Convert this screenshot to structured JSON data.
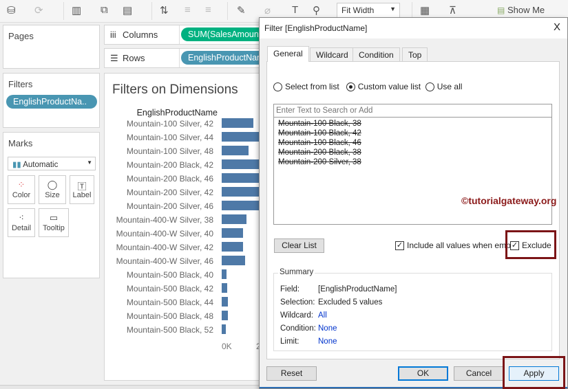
{
  "toolbar": {
    "fit_label": "Fit Width",
    "show_me": "Show Me"
  },
  "shelves": {
    "pages": "Pages",
    "filters": "Filters",
    "filter_pill": "EnglishProductNa..",
    "marks": "Marks",
    "mark_type": "Automatic",
    "columns": "Columns",
    "columns_pill": "SUM(SalesAmount)",
    "rows": "Rows",
    "rows_pill": "EnglishProductName"
  },
  "marks_buttons": [
    "Color",
    "Size",
    "Label",
    "Detail",
    "Tooltip"
  ],
  "viz": {
    "title": "Filters on Dimensions",
    "header": "EnglishProductName",
    "axis_tick": "0K",
    "axis_tick2": "2",
    "rows": [
      {
        "label": "Mountain-100 Silver, 42",
        "value": 46
      },
      {
        "label": "Mountain-100 Silver, 44",
        "value": 60
      },
      {
        "label": "Mountain-100 Silver, 48",
        "value": 39
      },
      {
        "label": "Mountain-200 Black, 42",
        "value": 60
      },
      {
        "label": "Mountain-200 Black, 46",
        "value": 60
      },
      {
        "label": "Mountain-200 Silver, 42",
        "value": 60
      },
      {
        "label": "Mountain-200 Silver, 46",
        "value": 60
      },
      {
        "label": "Mountain-400-W Silver, 38",
        "value": 36
      },
      {
        "label": "Mountain-400-W Silver, 40",
        "value": 31
      },
      {
        "label": "Mountain-400-W Silver, 42",
        "value": 31
      },
      {
        "label": "Mountain-400-W Silver, 46",
        "value": 34
      },
      {
        "label": "Mountain-500 Black, 40",
        "value": 7
      },
      {
        "label": "Mountain-500 Black, 42",
        "value": 8
      },
      {
        "label": "Mountain-500 Black, 44",
        "value": 9
      },
      {
        "label": "Mountain-500 Black, 48",
        "value": 9
      },
      {
        "label": "Mountain-500 Black, 52",
        "value": 6
      }
    ]
  },
  "dialog": {
    "title": "Filter [EnglishProductName]",
    "close": "X",
    "tabs": [
      "General",
      "Wildcard",
      "Condition",
      "Top"
    ],
    "radios": [
      "Select from list",
      "Custom value list",
      "Use all"
    ],
    "search_placeholder": "Enter Text to Search or Add",
    "items": [
      "Mountain-100 Black, 38",
      "Mountain-100 Black, 42",
      "Mountain-100 Black, 46",
      "Mountain-200 Black, 38",
      "Mountain-200 Silver, 38"
    ],
    "watermark": "©tutorialgateway.org",
    "clear_list": "Clear List",
    "include_all": "Include all values when empty",
    "exclude": "Exclude",
    "summary": {
      "title": "Summary",
      "rows": [
        {
          "k": "Field:",
          "v": "[EnglishProductName]"
        },
        {
          "k": "Selection:",
          "v": "Excluded 5 values"
        },
        {
          "k": "Wildcard:",
          "v": "All"
        },
        {
          "k": "Condition:",
          "v": "None"
        },
        {
          "k": "Limit:",
          "v": "None"
        }
      ]
    },
    "buttons": {
      "reset": "Reset",
      "ok": "OK",
      "cancel": "Cancel",
      "apply": "Apply"
    }
  },
  "colors": {
    "columns_pill": "#00b180",
    "rows_pill": "#4996b2",
    "bar": "#4e79a7",
    "highlight": "#7b1416"
  }
}
